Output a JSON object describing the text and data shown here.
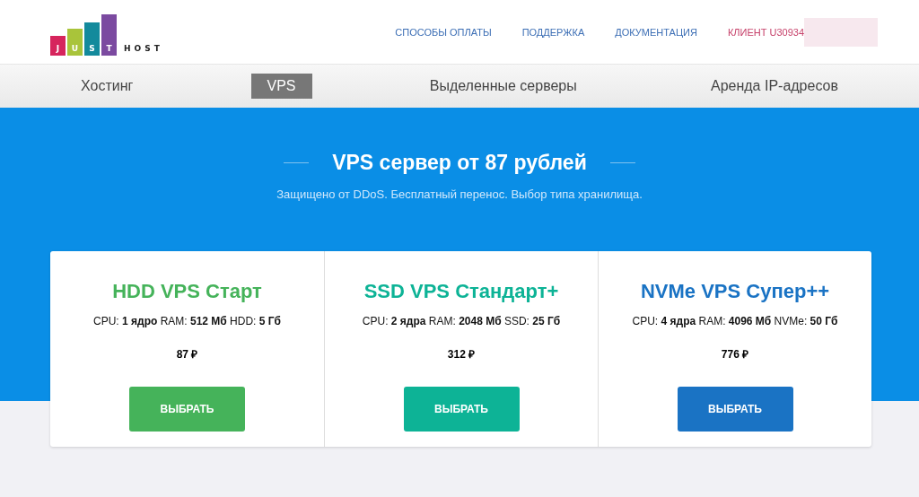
{
  "logo": {
    "letters": [
      "J",
      "U",
      "S",
      "T"
    ],
    "word": "HOST"
  },
  "top_links": [
    {
      "label": "СПОСОБЫ ОПЛАТЫ",
      "kind": "link"
    },
    {
      "label": "ПОДДЕРЖКА",
      "kind": "link"
    },
    {
      "label": "ДОКУМЕНТАЦИЯ",
      "kind": "link"
    },
    {
      "label": "КЛИЕНТ U30934",
      "kind": "account"
    }
  ],
  "tabs": [
    {
      "label": "Хостинг",
      "selected": false
    },
    {
      "label": "VPS",
      "selected": true
    },
    {
      "label": "Выделенные серверы",
      "selected": false
    },
    {
      "label": "Аренда IP-адресов",
      "selected": false
    }
  ],
  "hero": {
    "title": "VPS сервер от 87 рублей",
    "subtitle": "Защищено от DDoS. Бесплатный перенос. Выбор типа хранилища."
  },
  "plans": [
    {
      "name": "HDD VPS Старт",
      "color": "#45b35a",
      "specs": "CPU: **1 ядро** RAM: **512 Мб** HDD: **5 Гб**",
      "price": "87 ₽",
      "button": "ВЫБРАТЬ"
    },
    {
      "name": "SSD VPS Стандарт+",
      "color": "#0db396",
      "specs": "CPU: **2 ядра** RAM: **2048 Мб** SSD: **25 Гб**",
      "price": "312 ₽",
      "button": "ВЫБРАТЬ"
    },
    {
      "name": "NVMe VPS Супер++",
      "color": "#1a73c4",
      "specs": "CPU: **4 ядра** RAM: **4096 Мб** NVMe: **50 Гб**",
      "price": "776 ₽",
      "button": "ВЫБРАТЬ"
    }
  ]
}
